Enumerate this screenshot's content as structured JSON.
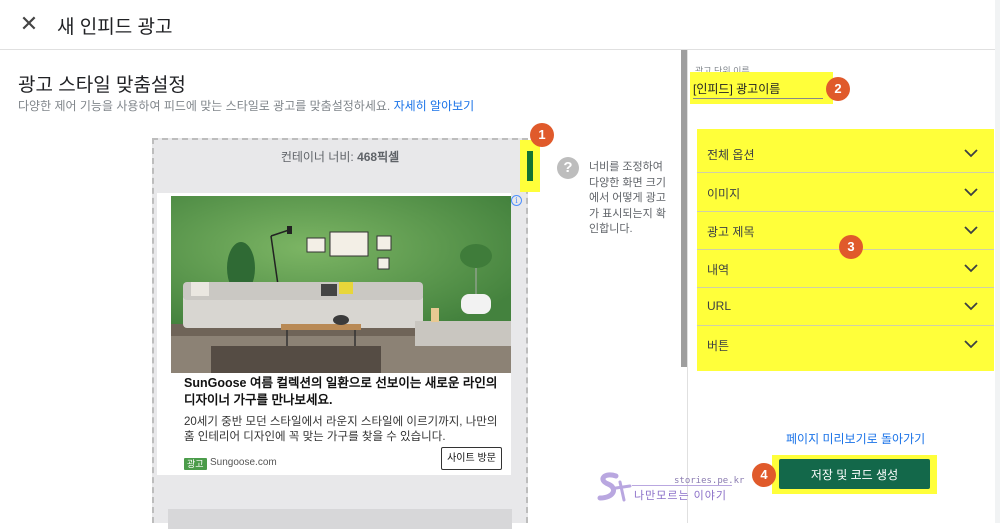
{
  "header": {
    "close_icon": "close-icon",
    "title": "새 인피드 광고"
  },
  "section": {
    "title": "광고 스타일 맞춤설정",
    "description": "다양한 제어 기능을 사용하여 피드에 맞는 스타일로 광고를 맞춤설정하세요.",
    "learn_more": "자세히 알아보기"
  },
  "preview": {
    "container_width_label": "컨테이너 너비: ",
    "container_width_value": "468픽셀",
    "ad": {
      "headline": "SunGoose 여름 컬렉션의 일환으로 선보이는 새로운 라인의 디자이너 가구를 만나보세요.",
      "description": "20세기 중반 모던 스타일에서 라운지 스타일에 이르기까지, 나만의 홈 인테리어 디자인에 꼭 맞는 가구를 찾을 수 있습니다.",
      "badge": "광고",
      "domain": "Sungoose.com",
      "cta": "사이트 방문",
      "info_icon": "info-icon"
    }
  },
  "help": {
    "icon": "help-icon",
    "text": "너비를 조정하여 다양한 화면 크기에서 어떻게 광고가 표시되는지 확인합니다."
  },
  "right_panel": {
    "unit_name_label": "광고 단위 이름",
    "unit_name_value": "[인피드] 광고이름",
    "options": [
      "전체 옵션",
      "이미지",
      "광고 제목",
      "내역",
      "URL",
      "버튼"
    ],
    "back_link": "페이지 미리보기로 돌아가기",
    "save_button": "저장 및 코드 생성"
  },
  "markers": [
    "1",
    "2",
    "3",
    "4"
  ],
  "watermark": {
    "site": "stories.pe.kr",
    "text": "나만모르는 이야기"
  },
  "colors": {
    "highlight": "#ffff3a",
    "marker": "#e05a2b",
    "primary": "#13684a",
    "link": "#1a73e8"
  }
}
